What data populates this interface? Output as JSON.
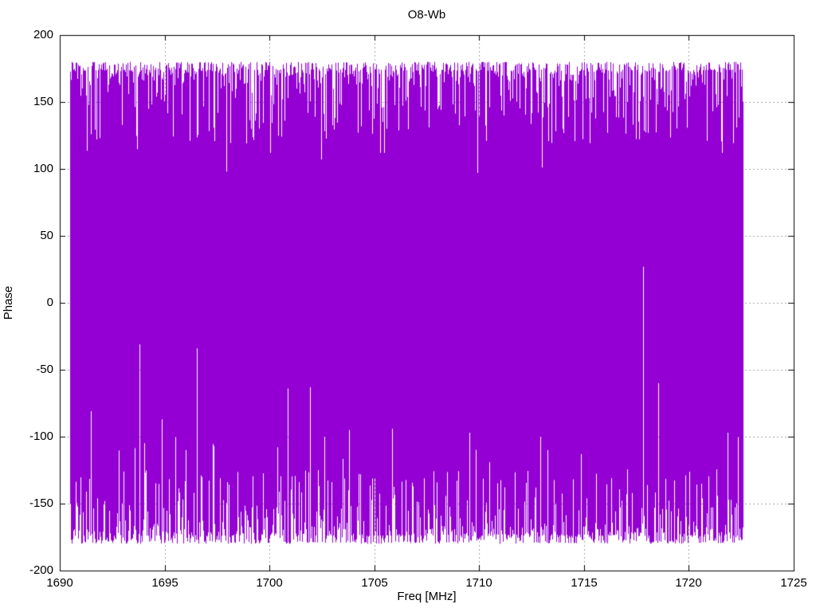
{
  "chart_data": {
    "type": "line",
    "title": "O8-Wb",
    "xlabel": "Freq [MHz]",
    "ylabel": "Phase",
    "xlim": [
      1690,
      1725
    ],
    "ylim": [
      -200,
      200
    ],
    "x_ticks": [
      1690,
      1695,
      1700,
      1705,
      1710,
      1715,
      1720,
      1725
    ],
    "y_ticks": [
      -200,
      -150,
      -100,
      -50,
      0,
      50,
      100,
      150,
      200
    ],
    "grid": true,
    "grid_style": "dotted",
    "legend": false,
    "background_color": "#ffffff",
    "axis_color": "#000000",
    "grid_color": "#a6a6a6",
    "series": [
      {
        "name": "phase",
        "color": "#9400d3",
        "style": "wrapped-phase-noise",
        "description": "Densely wrapped interferometric phase noise spanning approximately -180 to +180 degrees across the band; plotted with connecting lines so the trace fills the band solid violet with ragged comb-like top and bottom edges and occasional narrow white gaps.",
        "x_range": [
          1690.5,
          1722.55
        ],
        "phase_wrap_limit": 180,
        "top_envelope_range": [
          164,
          180
        ],
        "bottom_envelope_range": [
          -180,
          -164
        ],
        "noise_seed": 1717,
        "top_gap": {
          "probability": 0.5,
          "typical_depth_to": [
            120,
            174
          ]
        },
        "bottom_gap": {
          "probability": 0.5,
          "typical_height_to": [
            -174,
            -110
          ]
        },
        "top_dips": [
          {
            "x": 1691.9,
            "to": 123
          },
          {
            "x": 1697.95,
            "to": 98
          },
          {
            "x": 1698.9,
            "to": 119
          },
          {
            "x": 1702.45,
            "to": 107
          },
          {
            "x": 1707.6,
            "to": 131
          },
          {
            "x": 1709.9,
            "to": 97
          },
          {
            "x": 1713.0,
            "to": 101
          },
          {
            "x": 1716.1,
            "to": 127
          },
          {
            "x": 1720.85,
            "to": 121
          }
        ],
        "bottom_spikes": [
          {
            "x": 1691.5,
            "to": -81
          },
          {
            "x": 1693.8,
            "to": -31
          },
          {
            "x": 1694.85,
            "to": -87
          },
          {
            "x": 1696.55,
            "to": -34
          },
          {
            "x": 1700.85,
            "to": -64
          },
          {
            "x": 1701.95,
            "to": -63
          },
          {
            "x": 1703.8,
            "to": -95
          },
          {
            "x": 1705.85,
            "to": -94
          },
          {
            "x": 1709.55,
            "to": -97
          },
          {
            "x": 1710.5,
            "to": -119
          },
          {
            "x": 1713.25,
            "to": -110
          },
          {
            "x": 1714.85,
            "to": -113
          },
          {
            "x": 1716.3,
            "to": -131
          },
          {
            "x": 1717.8,
            "to": 27
          },
          {
            "x": 1718.55,
            "to": -60
          },
          {
            "x": 1721.85,
            "to": -97
          }
        ]
      }
    ]
  }
}
